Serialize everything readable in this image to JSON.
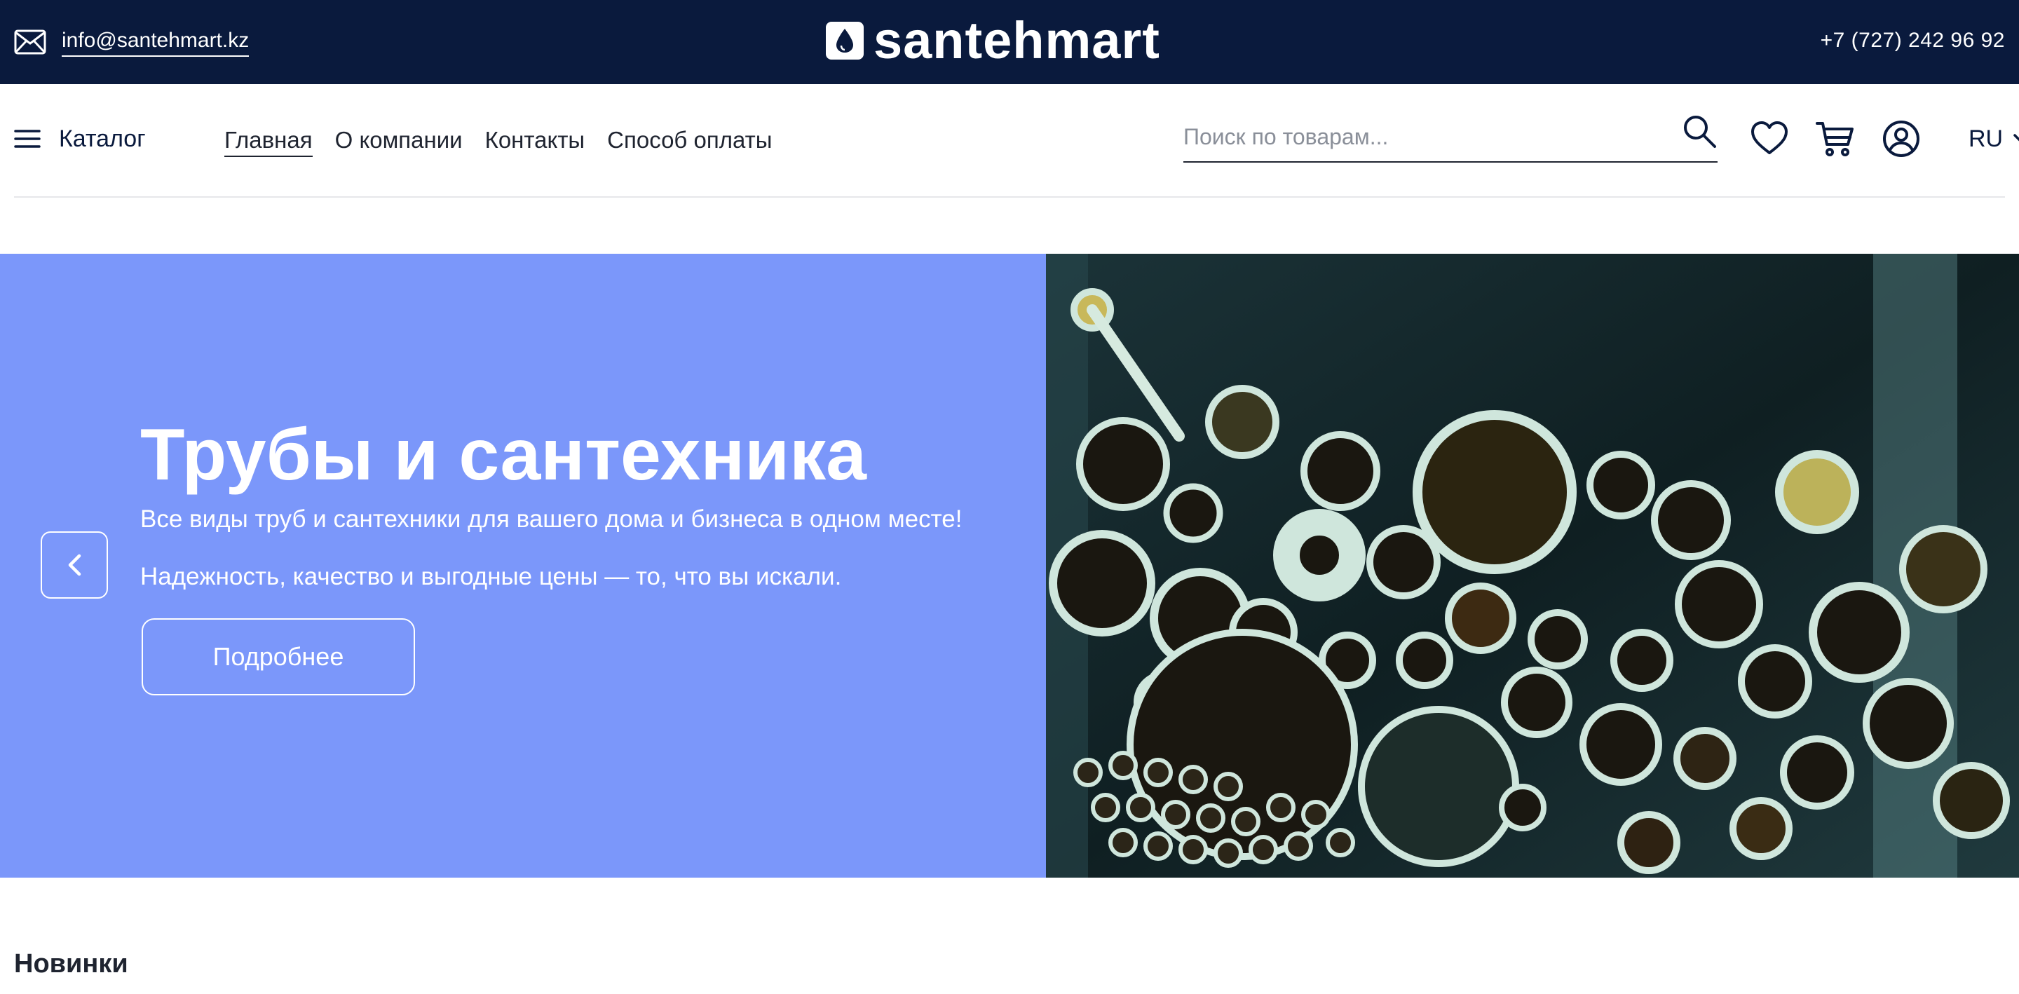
{
  "topbar": {
    "email": "info@santehmart.kz",
    "email_icon": "mail-icon",
    "logo_text": "santehmart",
    "logo_icon": "drop-logo-icon",
    "phone": "+7 (727) 242 96 92"
  },
  "nav": {
    "catalog_label": "Каталог",
    "catalog_icon": "hamburger-icon",
    "links": [
      {
        "label": "Главная",
        "active": true
      },
      {
        "label": "О компании"
      },
      {
        "label": "Контакты"
      },
      {
        "label": "Способ оплаты"
      }
    ],
    "search_placeholder": "Поиск по товарам...",
    "icons": [
      "search-icon",
      "heart-icon",
      "cart-icon",
      "user-icon"
    ],
    "language": "RU"
  },
  "hero": {
    "title": "Трубы и сантехника",
    "description": "Все виды труб и сантехники для вашего дома и бизнеса в одном месте! Надежность, качество и выгодные цены — то, что вы искали.",
    "button_label": "Подробнее",
    "panel_color": "#7b97fa",
    "prev_icon": "chevron-left-icon"
  },
  "section": {
    "title": "Новинки"
  },
  "colors": {
    "topbar": "#0a1a3d",
    "text": "#1f2430"
  }
}
